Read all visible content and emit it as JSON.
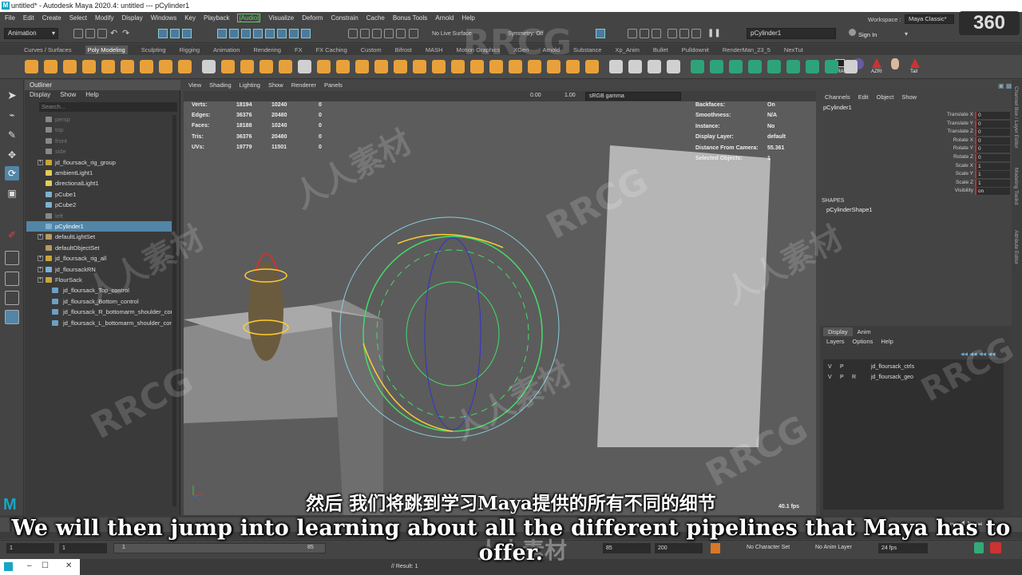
{
  "window": {
    "title": "untitled* - Autodesk Maya 2020.4: untitled   ---   pCylinder1",
    "logo": "M",
    "controls": [
      "–",
      "☐",
      "✕"
    ]
  },
  "menubar": [
    "File",
    "Edit",
    "Create",
    "Select",
    "Modify",
    "Display",
    "Windows",
    "Key",
    "Playback",
    "[Audio]",
    "Visualize",
    "Deform",
    "Constrain",
    "Cache",
    "Bonus Tools",
    "Arnold",
    "Help"
  ],
  "status": {
    "mode": "Animation",
    "live_surface": "No Live Surface",
    "symmetry": "Symmetry: Off",
    "name_field": "pCylinder1",
    "sign_in": "Sign In",
    "workspace_label": "Workspace :",
    "workspace": "Maya Classic*"
  },
  "shelf_tabs": [
    "Curves / Surfaces",
    "Poly Modeling",
    "Sculpting",
    "Rigging",
    "Animation",
    "Rendering",
    "FX",
    "FX Caching",
    "Custom",
    "Bifrost",
    "MASH",
    "Motion Graphics",
    "XGen",
    "Arnold",
    "Substance",
    "Xp_Anim",
    "Bullet",
    "Pulldownit",
    "RenderMan_23_5",
    "NexTut"
  ],
  "shelf_active": "Poly Modeling",
  "shelf_labels": {
    "lra": "LRA",
    "azri": "AZRI",
    "tail": "Tail"
  },
  "outliner": {
    "title": "Outliner",
    "menu": [
      "Display",
      "Show",
      "Help"
    ],
    "search_placeholder": "Search...",
    "items": [
      {
        "label": "persp",
        "dim": true,
        "icon": "camera-icon",
        "expand": false
      },
      {
        "label": "top",
        "dim": true,
        "icon": "camera-icon",
        "expand": false
      },
      {
        "label": "front",
        "dim": true,
        "icon": "camera-icon",
        "expand": false
      },
      {
        "label": "side",
        "dim": true,
        "icon": "camera-icon",
        "expand": false
      },
      {
        "label": "jd_floursack_rig_group",
        "dim": false,
        "icon": "group-icon",
        "expand": true
      },
      {
        "label": "ambientLight1",
        "dim": false,
        "icon": "light-icon",
        "expand": false
      },
      {
        "label": "directionalLight1",
        "dim": false,
        "icon": "light-icon",
        "expand": false
      },
      {
        "label": "pCube1",
        "dim": false,
        "icon": "mesh-icon",
        "expand": false
      },
      {
        "label": "pCube2",
        "dim": false,
        "icon": "mesh-icon",
        "expand": false
      },
      {
        "label": "left",
        "dim": true,
        "icon": "camera-icon",
        "expand": false
      },
      {
        "label": "pCylinder1",
        "dim": false,
        "icon": "mesh-icon",
        "expand": false,
        "selected": true
      },
      {
        "label": "defaultLightSet",
        "dim": false,
        "icon": "set-icon",
        "expand": true
      },
      {
        "label": "defaultObjectSet",
        "dim": false,
        "icon": "set-icon",
        "expand": false
      },
      {
        "label": "jd_floursack_rig_all",
        "dim": false,
        "icon": "group-icon",
        "expand": true
      },
      {
        "label": "jd_floursackRN",
        "dim": false,
        "icon": "reference-icon",
        "expand": true
      },
      {
        "label": "FlourSack",
        "dim": false,
        "icon": "group-icon",
        "expand": true
      },
      {
        "label": "jd_floursack_Top_control",
        "dim": false,
        "icon": "curve-icon",
        "expand": false,
        "indent": true
      },
      {
        "label": "jd_floursack_Bottom_control",
        "dim": false,
        "icon": "curve-icon",
        "expand": false,
        "indent": true
      },
      {
        "label": "jd_floursack_R_bottomarm_shoulder_cor",
        "dim": false,
        "icon": "curve-icon",
        "expand": false,
        "indent": true
      },
      {
        "label": "jd_floursack_L_bottomarm_shoulder_cor",
        "dim": false,
        "icon": "curve-icon",
        "expand": false,
        "indent": true
      }
    ]
  },
  "viewport": {
    "menu": [
      "View",
      "Shading",
      "Lighting",
      "Show",
      "Renderer",
      "Panels"
    ],
    "toolbar": {
      "v1": "0.00",
      "v2": "1.00",
      "colorspace": "sRGB gamma"
    },
    "stats": [
      {
        "label": "Verts:",
        "a": "18194",
        "b": "10240",
        "c": "0"
      },
      {
        "label": "Edges:",
        "a": "36376",
        "b": "20480",
        "c": "0"
      },
      {
        "label": "Faces:",
        "a": "18188",
        "b": "10240",
        "c": "0"
      },
      {
        "label": "Tris:",
        "a": "36376",
        "b": "20480",
        "c": "0"
      },
      {
        "label": "UVs:",
        "a": "19779",
        "b": "11501",
        "c": "0"
      }
    ],
    "info": [
      {
        "label": "Backfaces:",
        "value": "On"
      },
      {
        "label": "Smoothness:",
        "value": "N/A"
      },
      {
        "label": "Instance:",
        "value": "No"
      },
      {
        "label": "Display Layer:",
        "value": "default"
      },
      {
        "label": "Distance From Camera:",
        "value": "55.361"
      },
      {
        "label": "Selected Objects:",
        "value": "1"
      }
    ],
    "fps": "40.1 fps"
  },
  "channel_box": {
    "menu": [
      "Channels",
      "Edit",
      "Object",
      "Show"
    ],
    "object": "pCylinder1",
    "attrs": [
      {
        "label": "Translate X",
        "value": "0"
      },
      {
        "label": "Translate Y",
        "value": "0"
      },
      {
        "label": "Translate Z",
        "value": "0"
      },
      {
        "label": "Rotate X",
        "value": "0"
      },
      {
        "label": "Rotate Y",
        "value": "0"
      },
      {
        "label": "Rotate Z",
        "value": "0"
      },
      {
        "label": "Scale X",
        "value": "1"
      },
      {
        "label": "Scale Y",
        "value": "1"
      },
      {
        "label": "Scale Z",
        "value": "1"
      },
      {
        "label": "Visibility",
        "value": "on"
      }
    ],
    "shapes_label": "SHAPES",
    "shape": "pCylinderShape1"
  },
  "layer_editor": {
    "tabs": [
      "Display",
      "Anim"
    ],
    "menu": [
      "Layers",
      "Options",
      "Help"
    ],
    "layers": [
      {
        "v": "V",
        "p": "P",
        "r": "",
        "name": "jd_floursack_ctrls"
      },
      {
        "v": "V",
        "p": "P",
        "r": "R",
        "name": "jd_floursack_geo"
      }
    ]
  },
  "side_tabs": [
    "Channel Box / Layer Editor",
    "Modeling Toolkit",
    "Attribute Editor"
  ],
  "range": {
    "start": "1",
    "current": "1",
    "slider_start": "1",
    "slider_end": "85",
    "end_a": "85",
    "end_b": "200",
    "char_set": "No Character Set",
    "anim_layer": "No Anim Layer",
    "fps": "24 fps"
  },
  "cmdline": {
    "lang": "MEL",
    "result": "// Result: 1"
  },
  "subtitles": {
    "cn": "然后 我们将跳到学习Maya提供的所有不同的细节",
    "en": "We will then jump into learning about all the different pipelines that Maya has to offer."
  },
  "watermarks": {
    "rrcg": "RRCG",
    "renren": "人人素材",
    "badge": "360"
  },
  "colors": {
    "selection": "#5285a6",
    "accent_green": "#6c6",
    "ui_bg": "#444444"
  }
}
